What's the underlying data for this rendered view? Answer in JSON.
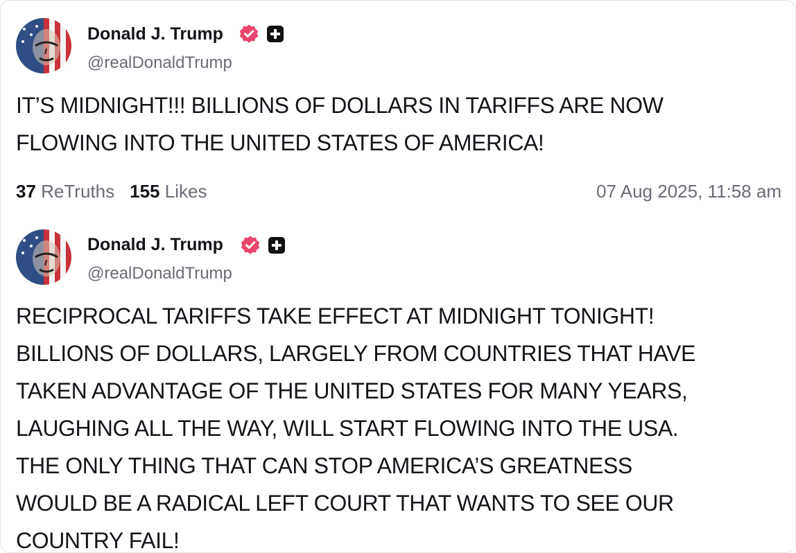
{
  "posts": [
    {
      "author": {
        "name": "Donald J. Trump",
        "handle": "@realDonaldTrump"
      },
      "lines": [
        "IT’S MIDNIGHT!!! BILLIONS OF DOLLARS IN TARIFFS ARE NOW",
        "FLOWING INTO THE UNITED STATES OF AMERICA!"
      ],
      "stats": {
        "retruths_count": "37",
        "retruths_label": "ReTruths",
        "likes_count": "155",
        "likes_label": "Likes"
      },
      "timestamp": "07 Aug 2025, 11:58 am"
    },
    {
      "author": {
        "name": "Donald J. Trump",
        "handle": "@realDonaldTrump"
      },
      "lines": [
        "RECIPROCAL TARIFFS TAKE EFFECT AT MIDNIGHT TONIGHT!",
        "BILLIONS OF DOLLARS, LARGELY FROM COUNTRIES THAT HAVE",
        "TAKEN ADVANTAGE OF THE UNITED STATES FOR MANY YEARS,",
        "LAUGHING ALL THE WAY, WILL START FLOWING INTO THE USA.",
        "THE ONLY THING THAT CAN STOP AMERICA’S GREATNESS",
        "WOULD BE A RADICAL LEFT COURT THAT WANTS TO SEE OUR",
        "COUNTRY FAIL!"
      ]
    }
  ],
  "icons": {
    "verified": "verified-badge-icon",
    "plus": "plus-badge-icon"
  },
  "colors": {
    "verified_badge": "#e8476d",
    "plus_badge": "#111111",
    "text_primary": "#14141a",
    "text_secondary": "#6b6b76"
  }
}
